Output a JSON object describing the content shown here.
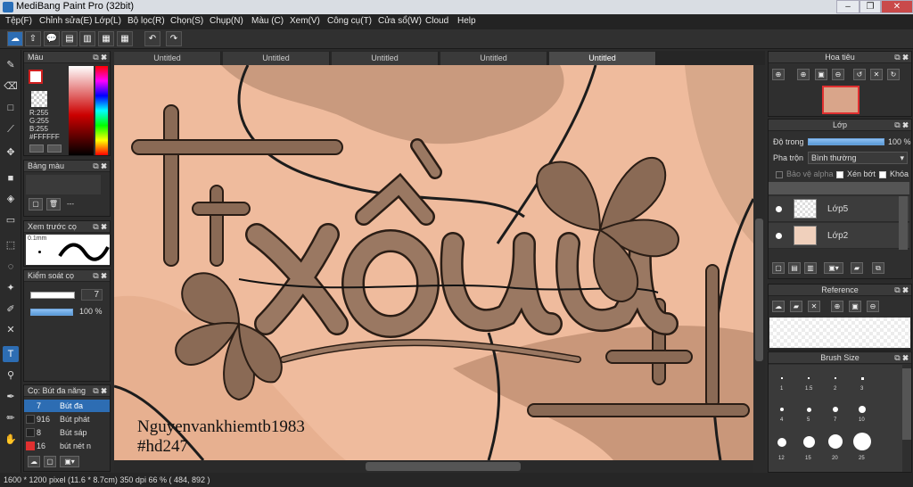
{
  "window": {
    "title": "MediBang Paint Pro (32bit)"
  },
  "menu": [
    "Tệp(F)",
    "Chỉnh sửa(E)",
    "Lớp(L)",
    "Bộ lọc(R)",
    "Chọn(S)",
    "Chụp(N)",
    "Màu (C)",
    "Xem(V)",
    "Công cụ(T)",
    "Cửa sổ(W)",
    "Cloud",
    "Help"
  ],
  "tabs": [
    "Untitled",
    "Untitled",
    "Untitled",
    "Untitled",
    "Untitled"
  ],
  "color_panel": {
    "title": "Màu",
    "r": "R:255",
    "g": "G:255",
    "b": "B:255",
    "hex": "#FFFFFF"
  },
  "swatch_panel": {
    "title": "Bảng màu",
    "empty": "---"
  },
  "preview_panel": {
    "title": "Xem trước cọ",
    "size": "0.1mm"
  },
  "brush_control": {
    "title": "Kiểm soát cọ",
    "size": "7",
    "opacity": "100 %"
  },
  "brush_list": {
    "title": "Cọ: Bút đa năng",
    "items": [
      {
        "num": "7",
        "name": "Bút đa",
        "color": "#2d6db3"
      },
      {
        "num": "916",
        "name": "Bút phát",
        "color": "#222222"
      },
      {
        "num": "8",
        "name": "Bút sáp",
        "color": "#222222"
      },
      {
        "num": "16",
        "name": "bút nét n",
        "color": "#e03030"
      }
    ]
  },
  "navigator": {
    "title": "Hoa tiêu"
  },
  "layer_panel": {
    "title": "Lớp",
    "opacity_label": "Độ trong",
    "opacity_value": "100 %",
    "blend_label": "Pha trộn",
    "blend_value": "Bình thường",
    "protect_alpha": "Bảo vệ alpha",
    "clip": "Xén bớt",
    "lock": "Khóa",
    "layers": [
      "Lớp5",
      "Lớp2"
    ]
  },
  "reference": {
    "title": "Reference"
  },
  "brush_size": {
    "title": "Brush Size",
    "labels": [
      "1",
      "1.5",
      "2",
      "3",
      "4",
      "5",
      "7",
      "10",
      "12",
      "15",
      "20",
      "25"
    ]
  },
  "canvas": {
    "signature1": "Nguyenvankhiemtb1983",
    "signature2": "#hd247",
    "artwork_text": "xấu"
  },
  "status": "1600 * 1200 pixel   (11.6 * 8.7cm)   350 dpi   66 %   ( 484, 892 )"
}
